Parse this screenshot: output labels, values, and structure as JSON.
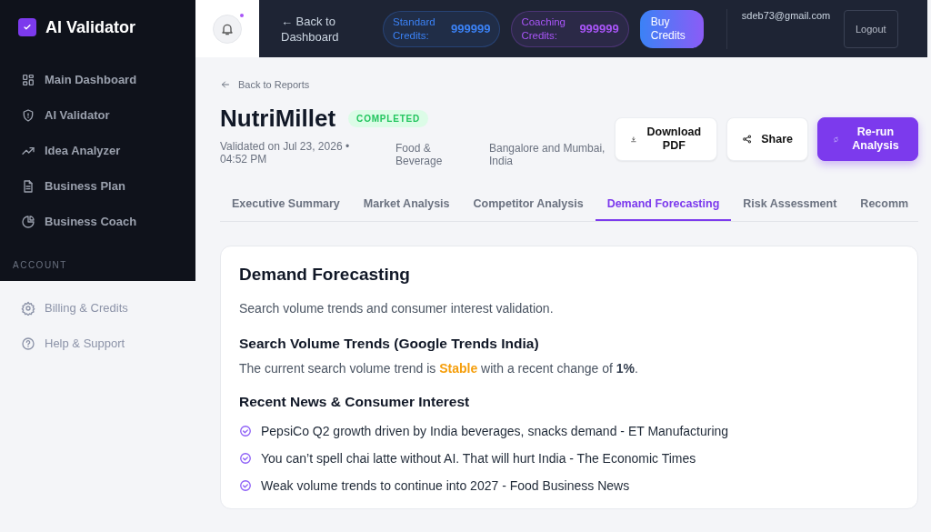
{
  "sidebar": {
    "brand": "AI Validator",
    "items": [
      {
        "label": "Main Dashboard",
        "kind": "grid"
      },
      {
        "label": "AI Validator",
        "kind": "shield"
      },
      {
        "label": "Idea Analyzer",
        "kind": "trend"
      },
      {
        "label": "Business Plan",
        "kind": "doc"
      },
      {
        "label": "Business Coach",
        "kind": "pie"
      }
    ],
    "section_label": "ACCOUNT",
    "account_items": [
      {
        "label": "Billing & Credits",
        "kind": "gear"
      },
      {
        "label": "Help & Support",
        "kind": "help"
      }
    ]
  },
  "topbar": {
    "notification_dot": true,
    "back_link": "← Back to Dashboard",
    "credits": [
      {
        "label": "Standard Credits:",
        "value": "999999",
        "color": "#3b82f6"
      },
      {
        "label": "Coaching Credits:",
        "value": "999999",
        "color": "#a855f7"
      }
    ],
    "buy_button": "Buy Credits",
    "email": "sdeb73@gmail.com",
    "logout": "Logout"
  },
  "report": {
    "back_link": "Back to Reports",
    "title": "NutriMillet",
    "status": "COMPLETED",
    "validated": "Validated on Jul 23, 2026 • 04:52 PM",
    "category": "Food & Beverage",
    "location": "Bangalore and Mumbai, India",
    "actions": [
      {
        "label": "Download PDF",
        "kind": "download"
      },
      {
        "label": "Share",
        "kind": "share"
      },
      {
        "label": "Re-run Analysis",
        "kind": "rerun"
      }
    ]
  },
  "tabs": [
    {
      "label": "Executive Summary",
      "selected": false
    },
    {
      "label": "Market Analysis",
      "selected": false
    },
    {
      "label": "Competitor Analysis",
      "selected": false
    },
    {
      "label": "Demand Forecasting",
      "selected": true
    },
    {
      "label": "Risk Assessment",
      "selected": false
    },
    {
      "label": "Recomm",
      "selected": false
    }
  ],
  "card": {
    "title": "Demand Forecasting",
    "subtitle": "Search volume trends and consumer interest validation.",
    "trends_heading": "Search Volume Trends (Google Trends India)",
    "trend_sentence": {
      "before": "The current search volume trend is ",
      "trend": "Stable",
      "middle": " with a recent change of ",
      "change": "1%",
      "after": "."
    },
    "news_heading": "Recent News & Consumer Interest",
    "news": [
      "PepsiCo Q2 growth driven by India beverages, snacks demand - ET Manufacturing",
      "You can’t spell chai latte without AI. That will hurt India - The Economic Times",
      "Weak volume trends to continue into 2027 - Food Business News"
    ]
  }
}
